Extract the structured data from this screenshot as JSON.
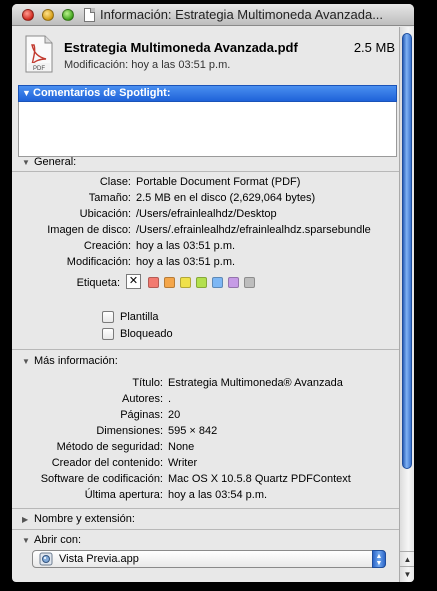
{
  "window": {
    "title": "Información: Estrategia Multimoneda Avanzada..."
  },
  "file": {
    "name": "Estrategia Multimoneda Avanzada.pdf",
    "size": "2.5 MB",
    "modified": "Modificación: hoy a las 03:51 p.m.",
    "icon_label": "PDF"
  },
  "spotlight": {
    "heading": "Comentarios de Spotlight:",
    "comments": ""
  },
  "general": {
    "heading": "General:",
    "rows": [
      {
        "label": "Clase:",
        "value": "Portable Document Format (PDF)"
      },
      {
        "label": "Tamaño:",
        "value": "2.5 MB en el disco (2,629,064 bytes)"
      },
      {
        "label": "Ubicación:",
        "value": "/Users/efrainlealhdz/Desktop"
      },
      {
        "label": "Imagen de disco:",
        "value": "/Users/.efrainlealhdz/efrainlealhdz.sparsebundle"
      },
      {
        "label": "Creación:",
        "value": "hoy a las 03:51 p.m."
      },
      {
        "label": "Modificación:",
        "value": "hoy a las 03:51 p.m."
      }
    ],
    "label_field": "Etiqueta:",
    "label_none_glyph": "✕",
    "label_colors": [
      "#f27a70",
      "#f4a64a",
      "#efe14a",
      "#b3e04d",
      "#7db7f4",
      "#c69be6",
      "#bdbdbd"
    ],
    "stationery": "Plantilla",
    "locked": "Bloqueado"
  },
  "more_info": {
    "heading": "Más información:",
    "rows": [
      {
        "label": "Título:",
        "value": "Estrategia Multimoneda® Avanzada"
      },
      {
        "label": "Autores:",
        "value": "."
      },
      {
        "label": "Páginas:",
        "value": "20"
      },
      {
        "label": "Dimensiones:",
        "value": "595 × 842"
      },
      {
        "label": "Método de seguridad:",
        "value": "None"
      },
      {
        "label": "Creador del contenido:",
        "value": "Writer"
      },
      {
        "label": "Software de codificación:",
        "value": "Mac OS X 10.5.8 Quartz PDFContext"
      },
      {
        "label": "Última apertura:",
        "value": "hoy a las 03:54 p.m."
      }
    ]
  },
  "name_ext": {
    "heading": "Nombre y extensión:"
  },
  "open_with": {
    "heading": "Abrir con:",
    "selected_app": "Vista Previa.app"
  }
}
